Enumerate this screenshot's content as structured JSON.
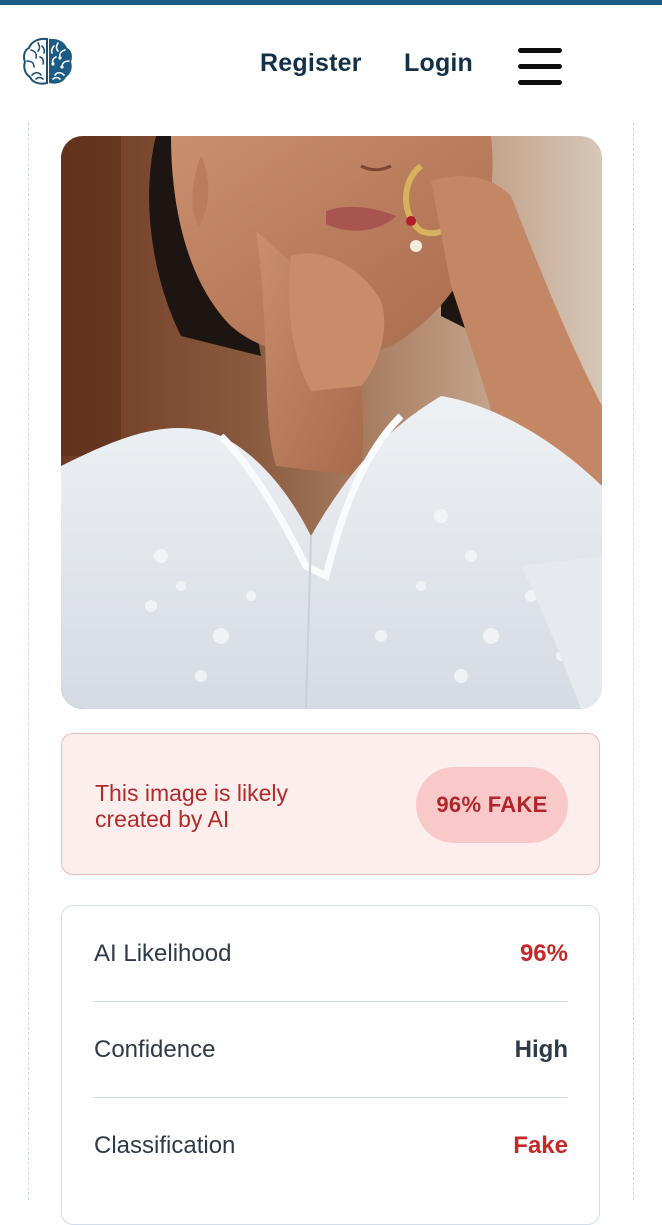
{
  "header": {
    "logo_icon": "brain-icon",
    "register_label": "Register",
    "login_label": "Login",
    "menu_icon": "hamburger-menu-icon"
  },
  "colors": {
    "accent": "#1b5c86",
    "fake_red": "#c62828",
    "verdict_bg": "#fdeeee",
    "badge_bg": "#f9c9c9",
    "neutral_value": "#2e3a48"
  },
  "analysis": {
    "image_icon": "analyzed-photo",
    "verdict_text": "This image is likely created by AI",
    "badge_text": "96% FAKE",
    "rows": [
      {
        "label": "AI Likelihood",
        "value": "96%",
        "value_color": "#c62828"
      },
      {
        "label": "Confidence",
        "value": "High",
        "value_color": "#2e3a48"
      },
      {
        "label": "Classification",
        "value": "Fake",
        "value_color": "#c62828"
      }
    ]
  }
}
